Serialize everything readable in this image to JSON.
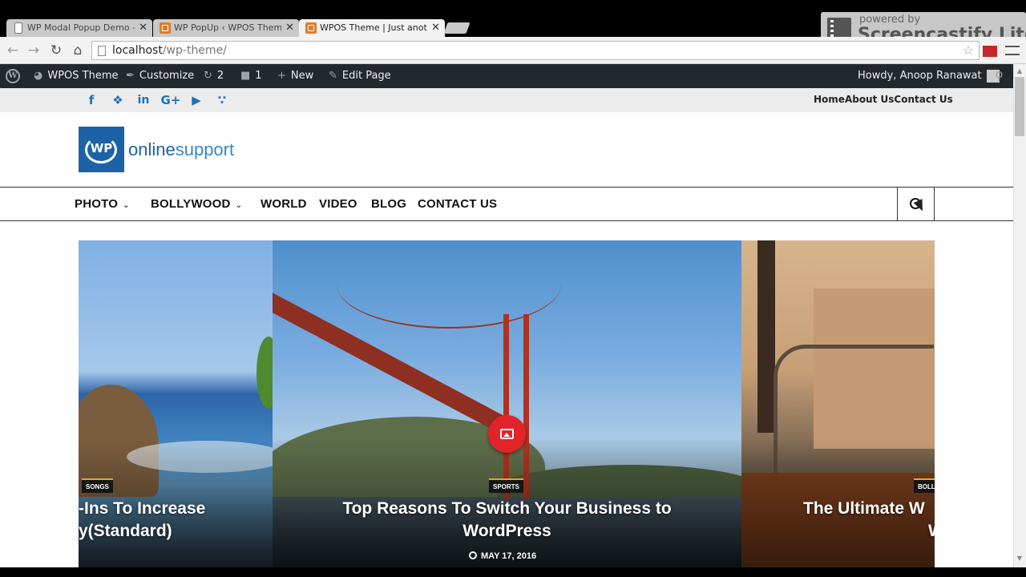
{
  "browser": {
    "tabs": [
      {
        "title": "WP Modal Popup Demo -",
        "icon": "document-icon"
      },
      {
        "title": "WP PopUp ‹ WPOS Theme",
        "icon": "wpos-icon"
      },
      {
        "title": "WPOS Theme | Just anoth",
        "icon": "wpos-icon",
        "active": true
      }
    ],
    "close_glyph": "✕",
    "url_host": "localhost",
    "url_path": "/wp-theme/"
  },
  "recorder": {
    "line1": "powered by",
    "line2": "Screencastify Lite"
  },
  "adminbar": {
    "site": "WPOS Theme",
    "customize": "Customize",
    "updates": "2",
    "comments": "1",
    "new": "New",
    "edit": "Edit Page",
    "howdy": "Howdy, Anoop Ranawat"
  },
  "topbar": {
    "social": [
      "facebook-icon",
      "twitter-icon",
      "linkedin-icon",
      "googleplus-icon",
      "youtube-icon",
      "rss-icon"
    ],
    "links": [
      "Home",
      "About Us",
      "Contact Us"
    ]
  },
  "logo": {
    "mark": "WP",
    "text_bold": "online",
    "text_light": "support"
  },
  "nav": {
    "items": [
      "PHOTO",
      "BOLLYWOOD",
      "WORLD",
      "VIDEO",
      "BLOG",
      "CONTACT US"
    ]
  },
  "slider": {
    "slides": [
      {
        "category": "SONGS",
        "title_line1": "-Ins To Increase",
        "title_line2": "y(Standard)"
      },
      {
        "category": "SPORTS",
        "title_line1": "Top Reasons To Switch Your Business to",
        "title_line2": "WordPress",
        "date": "MAY 17, 2016"
      },
      {
        "category": "BOLL",
        "title_line1": "The Ultimate W",
        "title_line2": "W"
      }
    ]
  },
  "colors": {
    "brand_blue": "#1c63a6",
    "admin_bar": "#23282d",
    "accent_red": "#e2232a",
    "badge_border": "#e8a521"
  }
}
